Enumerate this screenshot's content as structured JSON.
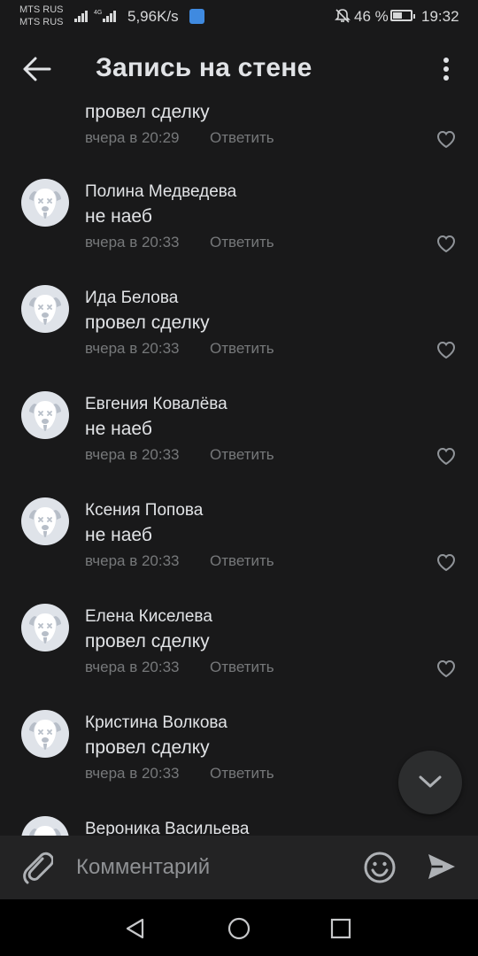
{
  "status_bar": {
    "carrier1": "MTS RUS",
    "carrier2": "MTS RUS",
    "net_speed": "5,96K/s",
    "battery": "46 %",
    "time": "19:32"
  },
  "header": {
    "title": "Запись на стене",
    "back_icon": "arrow-back-icon",
    "more_icon": "more-vertical-icon"
  },
  "comments": [
    {
      "author": "",
      "text": "провел сделку",
      "date": "вчера в 20:29",
      "reply": "Ответить",
      "avatar": "photo"
    },
    {
      "author": "Полина Медведева",
      "text": "не наеб",
      "date": "вчера в 20:33",
      "reply": "Ответить",
      "avatar": "deactivated-dog"
    },
    {
      "author": "Ида Белова",
      "text": "провел сделку",
      "date": "вчера в 20:33",
      "reply": "Ответить",
      "avatar": "deactivated-dog"
    },
    {
      "author": "Евгения Ковалёва",
      "text": "не наеб",
      "date": "вчера в 20:33",
      "reply": "Ответить",
      "avatar": "deactivated-dog"
    },
    {
      "author": "Ксения Попова",
      "text": "не наеб",
      "date": "вчера в 20:33",
      "reply": "Ответить",
      "avatar": "deactivated-dog"
    },
    {
      "author": "Елена Киселева",
      "text": "провел сделку",
      "date": "вчера в 20:33",
      "reply": "Ответить",
      "avatar": "deactivated-dog"
    },
    {
      "author": "Кристина Волкова",
      "text": "провел сделку",
      "date": "вчера в 20:33",
      "reply": "Ответить",
      "avatar": "deactivated-dog"
    },
    {
      "author": "Вероника Васильева",
      "text": "",
      "date": "",
      "reply": "",
      "avatar": "deactivated-dog"
    }
  ],
  "composer": {
    "placeholder": "Комментарий",
    "attach_icon": "paperclip-icon",
    "emoji_icon": "smile-icon",
    "send_icon": "send-icon"
  },
  "colors": {
    "background": "#19191a",
    "text_primary": "#e1e3e6",
    "text_secondary": "#76787a",
    "composer_bg": "#232324",
    "avatar_bg": "#dfe3e9"
  }
}
